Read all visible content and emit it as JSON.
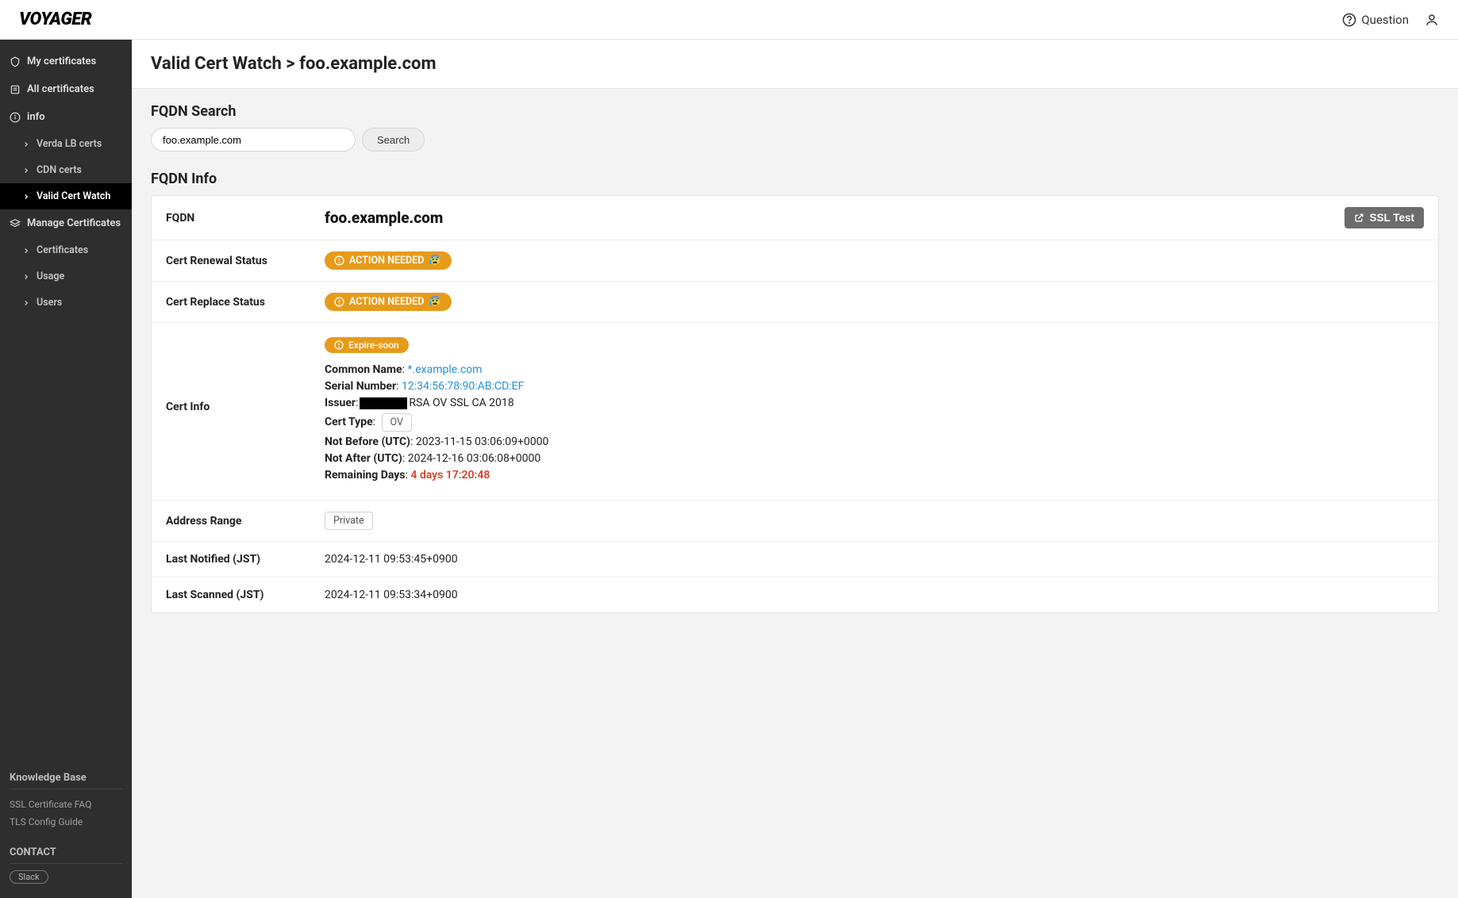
{
  "header": {
    "brand": "VOYAGER",
    "question_label": "Question"
  },
  "sidebar": {
    "nav": {
      "my_certs": "My certificates",
      "all_certs": "All certificates",
      "info": "info",
      "info_children": {
        "verda": "Verda LB certs",
        "cdn": "CDN certs",
        "valid_watch": "Valid Cert Watch"
      },
      "manage": "Manage Certificates",
      "manage_children": {
        "certificates": "Certificates",
        "usage": "Usage",
        "users": "Users"
      }
    },
    "kb_heading": "Knowledge Base",
    "kb_links": {
      "faq": "SSL Certificate FAQ",
      "tls": "TLS Config Guide"
    },
    "contact_heading": "CONTACT",
    "contact_badge": "Slack"
  },
  "main": {
    "page_title": "Valid Cert Watch > foo.example.com",
    "search_heading": "FQDN Search",
    "search_value": "foo.example.com",
    "search_btn": "Search",
    "info_heading": "FQDN Info",
    "rows": {
      "fqdn_label": "FQDN",
      "fqdn_value": "foo.example.com",
      "ssl_test_btn": "SSL Test",
      "renewal_label": "Cert Renewal Status",
      "replace_label": "Cert Replace Status",
      "action_needed_badge": "ACTION NEEDED",
      "cert_info_label": "Cert Info",
      "expire_soon_badge": "Expire-soon",
      "cn_label": "Common Name",
      "cn_value": "*.example.com",
      "serial_label": "Serial Number",
      "serial_value": "12:34:56:78:90:AB:CD:EF",
      "issuer_label": "Issuer",
      "issuer_suffix": "RSA OV SSL CA 2018",
      "cert_type_label": "Cert Type",
      "cert_type_value": "OV",
      "not_before_label": "Not Before (UTC)",
      "not_before_value": "2023-11-15 03:06:09+0000",
      "not_after_label": "Not After (UTC)",
      "not_after_value": "2024-12-16 03:06:08+0000",
      "remaining_label": "Remaining Days",
      "remaining_value": "4 days 17:20:48",
      "address_label": "Address Range",
      "address_value": "Private",
      "notified_label": "Last Notified (JST)",
      "notified_value": "2024-12-11 09:53:45+0900",
      "scanned_label": "Last Scanned (JST)",
      "scanned_value": "2024-12-11 09:53:34+0900"
    }
  }
}
